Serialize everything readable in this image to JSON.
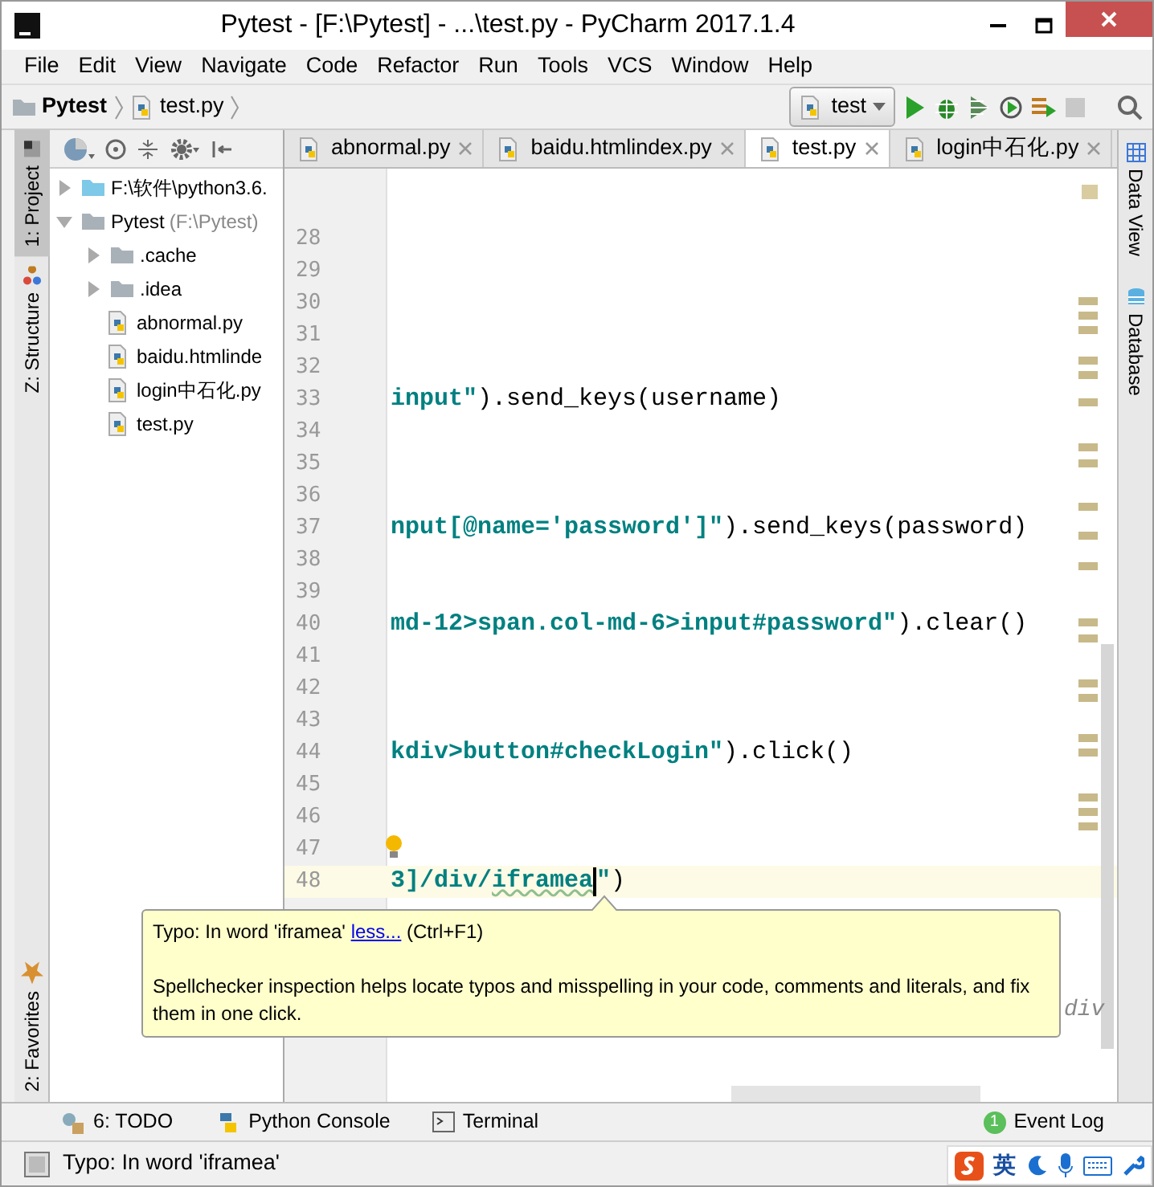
{
  "window": {
    "title": "Pytest - [F:\\Pytest] - ...\\test.py - PyCharm 2017.1.4"
  },
  "menu": [
    "File",
    "Edit",
    "View",
    "Navigate",
    "Code",
    "Refactor",
    "Run",
    "Tools",
    "VCS",
    "Window",
    "Help"
  ],
  "breadcrumb": [
    "Pytest",
    "test.py"
  ],
  "run_config": {
    "label": "test"
  },
  "left_tool_windows": [
    {
      "label": "1: Project",
      "selected": true
    },
    {
      "label": "Z: Structure",
      "selected": false
    }
  ],
  "favorites": {
    "label": "2: Favorites"
  },
  "project_tree": [
    {
      "label": "F:\\软件\\python3.6.",
      "kind": "library",
      "expanded": false
    },
    {
      "label": "Pytest",
      "hint": "(F:\\Pytest)",
      "kind": "folder",
      "expanded": true,
      "children": [
        {
          "label": ".cache",
          "kind": "folder",
          "expanded": false
        },
        {
          "label": ".idea",
          "kind": "folder",
          "expanded": false
        },
        {
          "label": "abnormal.py",
          "kind": "python"
        },
        {
          "label": "baidu.htmlinde",
          "kind": "python"
        },
        {
          "label": "login中石化.py",
          "kind": "python"
        },
        {
          "label": "test.py",
          "kind": "python"
        }
      ]
    }
  ],
  "editor_tabs": [
    {
      "label": "abnormal.py",
      "selected": false
    },
    {
      "label": "baidu.htmlindex.py",
      "selected": false
    },
    {
      "label": "test.py",
      "selected": true
    },
    {
      "label": "login中石化.py",
      "selected": false
    }
  ],
  "code_lines": [
    {
      "number": "28",
      "current": false
    },
    {
      "number": "29",
      "current": false
    },
    {
      "number": "30",
      "current": false
    },
    {
      "number": "31",
      "current": false
    },
    {
      "number": "32",
      "current": false
    },
    {
      "number": "33",
      "current": false,
      "segments": [
        {
          "text": "input\"",
          "kind": "string"
        },
        {
          "text": ").send_keys(username)",
          "kind": "plain"
        }
      ]
    },
    {
      "number": "34",
      "current": false
    },
    {
      "number": "35",
      "current": false
    },
    {
      "number": "36",
      "current": false
    },
    {
      "number": "37",
      "current": false,
      "segments": [
        {
          "text": "nput[@name='password']\"",
          "kind": "string"
        },
        {
          "text": ").send_keys(password)",
          "kind": "plain"
        }
      ]
    },
    {
      "number": "38",
      "current": false
    },
    {
      "number": "39",
      "current": false
    },
    {
      "number": "40",
      "current": false,
      "segments": [
        {
          "text": "md-12>span.col-md-6>input#password\"",
          "kind": "string"
        },
        {
          "text": ").clear()",
          "kind": "plain"
        }
      ]
    },
    {
      "number": "41",
      "current": false
    },
    {
      "number": "42",
      "current": false
    },
    {
      "number": "43",
      "current": false
    },
    {
      "number": "44",
      "current": false,
      "segments": [
        {
          "text": "kdiv>button#checkLogin\"",
          "kind": "string"
        },
        {
          "text": ").click()",
          "kind": "plain"
        }
      ]
    },
    {
      "number": "45",
      "current": false
    },
    {
      "number": "46",
      "current": false
    },
    {
      "number": "47",
      "current": false
    },
    {
      "number": "48",
      "current": true,
      "segments": [
        {
          "text": "3]/div/",
          "kind": "string"
        },
        {
          "text": "iframea",
          "kind": "typo"
        },
        {
          "text": "\"",
          "kind": "string"
        },
        {
          "text": ")",
          "kind": "plain"
        }
      ]
    }
  ],
  "code_fragment": "div",
  "tooltip": {
    "prefix": "Typo: In word 'iframea'",
    "link": "less...",
    "shortcut": "(Ctrl+F1)",
    "description": "Spellchecker inspection helps locate typos and misspelling in your code, comments and literals, and fix them in one click."
  },
  "right_tool_windows": [
    "Data View",
    "Database"
  ],
  "bottom_tools": [
    "6: TODO",
    "Python Console",
    "Terminal"
  ],
  "event_log": {
    "label": "Event Log",
    "count": "1"
  },
  "status": {
    "message": "Typo: In word 'iframea'"
  },
  "ime": {
    "label": "英"
  }
}
